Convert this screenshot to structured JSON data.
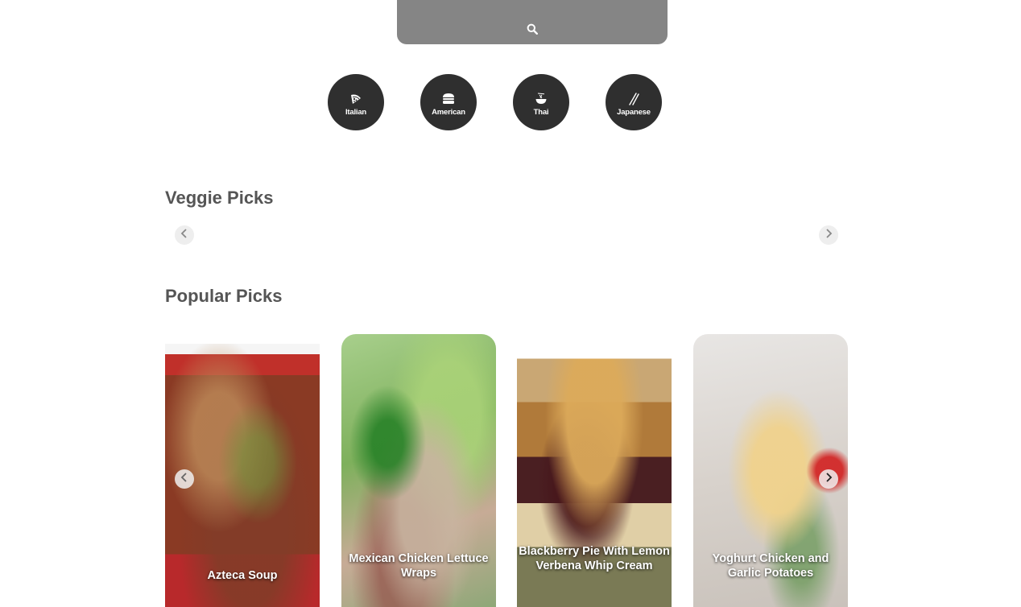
{
  "search": {
    "placeholder": "",
    "icon": "search-icon"
  },
  "cuisines": [
    {
      "label": "Italian",
      "icon": "pizza-icon"
    },
    {
      "label": "American",
      "icon": "burger-icon"
    },
    {
      "label": "Thai",
      "icon": "noodle-bowl-icon"
    },
    {
      "label": "Japanese",
      "icon": "chopsticks-icon"
    }
  ],
  "sections": {
    "veggie": {
      "title": "Veggie Picks"
    },
    "popular": {
      "title": "Popular Picks"
    }
  },
  "popular_cards": [
    {
      "title": "Azteca Soup"
    },
    {
      "title": "Mexican Chicken Lettuce Wraps"
    },
    {
      "title": "Blackberry Pie With Lemon Verbena Whip Cream"
    },
    {
      "title": "Yoghurt Chicken and Garlic Potatoes"
    }
  ],
  "colors": {
    "search_bg": "#858585",
    "cuisine_bg": "#2f2f2f",
    "title_text": "#555555"
  }
}
